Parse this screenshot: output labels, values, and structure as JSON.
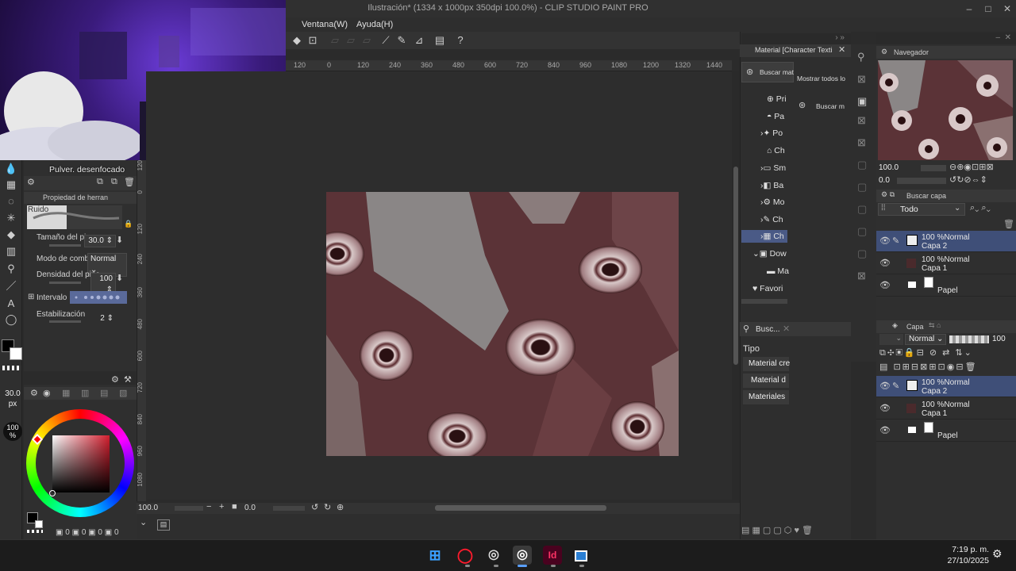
{
  "window": {
    "title": "Ilustración* (1334 x 1000px 350dpi 100.0%) - CLIP STUDIO PAINT PRO"
  },
  "menu": {
    "items": [
      "Ventana(W)",
      "Ayuda(H)"
    ]
  },
  "hruler": {
    "ticks": [
      "120",
      "0",
      "120",
      "240",
      "360",
      "480",
      "600",
      "720",
      "840",
      "960",
      "1080",
      "1200",
      "1320",
      "1440"
    ]
  },
  "vruler": {
    "ticks": [
      "120",
      "0",
      "120",
      "240",
      "360",
      "480",
      "600",
      "720",
      "840",
      "960",
      "1080",
      "1200"
    ]
  },
  "subtool": {
    "title": "Pulver. desenfocado",
    "property_title": "Propiedad de herran",
    "brush_name": "Ruido",
    "size_label": "Tamaño del pince",
    "size_value": "30.0",
    "blend_label": "Modo de combina",
    "blend_value": "Normal",
    "density_label": "Densidad del pinc",
    "density_value": "100",
    "interval_label": "Intervalo",
    "stabilization_label": "Estabilización",
    "stabilization_value": "2"
  },
  "brush_indicator": {
    "size": "30.0",
    "unit": "px",
    "opacity": "100",
    "opacity_unit": "%"
  },
  "color": {
    "main": "#000000",
    "sub": "#ffffff",
    "accent": "#3f4f78"
  },
  "color_counts": [
    "0",
    "0",
    "0",
    "0"
  ],
  "canvas_status": {
    "zoom": "100.0",
    "angle": "0.0"
  },
  "material_panel": {
    "tab": "Material [Character Texti",
    "search_button": "Buscar mat",
    "show_all": "Mostrar todos lo",
    "search_button2": "Buscar m",
    "tree": [
      "Pri",
      "Pa",
      "Po",
      "Ch",
      "Sm",
      "Ba",
      "Mo",
      "Ch",
      "Ch",
      "Dow",
      "Ma",
      "Favori"
    ]
  },
  "search_panel": {
    "tab": "Busc...",
    "tipo_label": "Tipo",
    "items": [
      "Material cre",
      "Material d",
      "Materiales"
    ]
  },
  "navigator": {
    "tab": "Navegador",
    "zoom": "100.0",
    "angle": "0.0"
  },
  "layer_search": {
    "tab": "Buscar capa",
    "filter": "Todo"
  },
  "layers_top": [
    {
      "mode": "100 %Normal",
      "name": "Capa 2",
      "selected": true
    },
    {
      "mode": "100 %Normal",
      "name": "Capa 1",
      "selected": false
    },
    {
      "mode": "",
      "name": "Papel",
      "selected": false
    }
  ],
  "layer_panel": {
    "tab": "Capa",
    "blend_mode": "Normal",
    "opacity": "100"
  },
  "layers_bottom": [
    {
      "mode": "100 %Normal",
      "name": "Capa 2",
      "selected": true
    },
    {
      "mode": "100 %Normal",
      "name": "Capa 1",
      "selected": false
    },
    {
      "mode": "",
      "name": "Papel",
      "selected": false
    }
  ],
  "taskbar": {
    "time": "7:19 p. m.",
    "date": "27/10/2025"
  }
}
